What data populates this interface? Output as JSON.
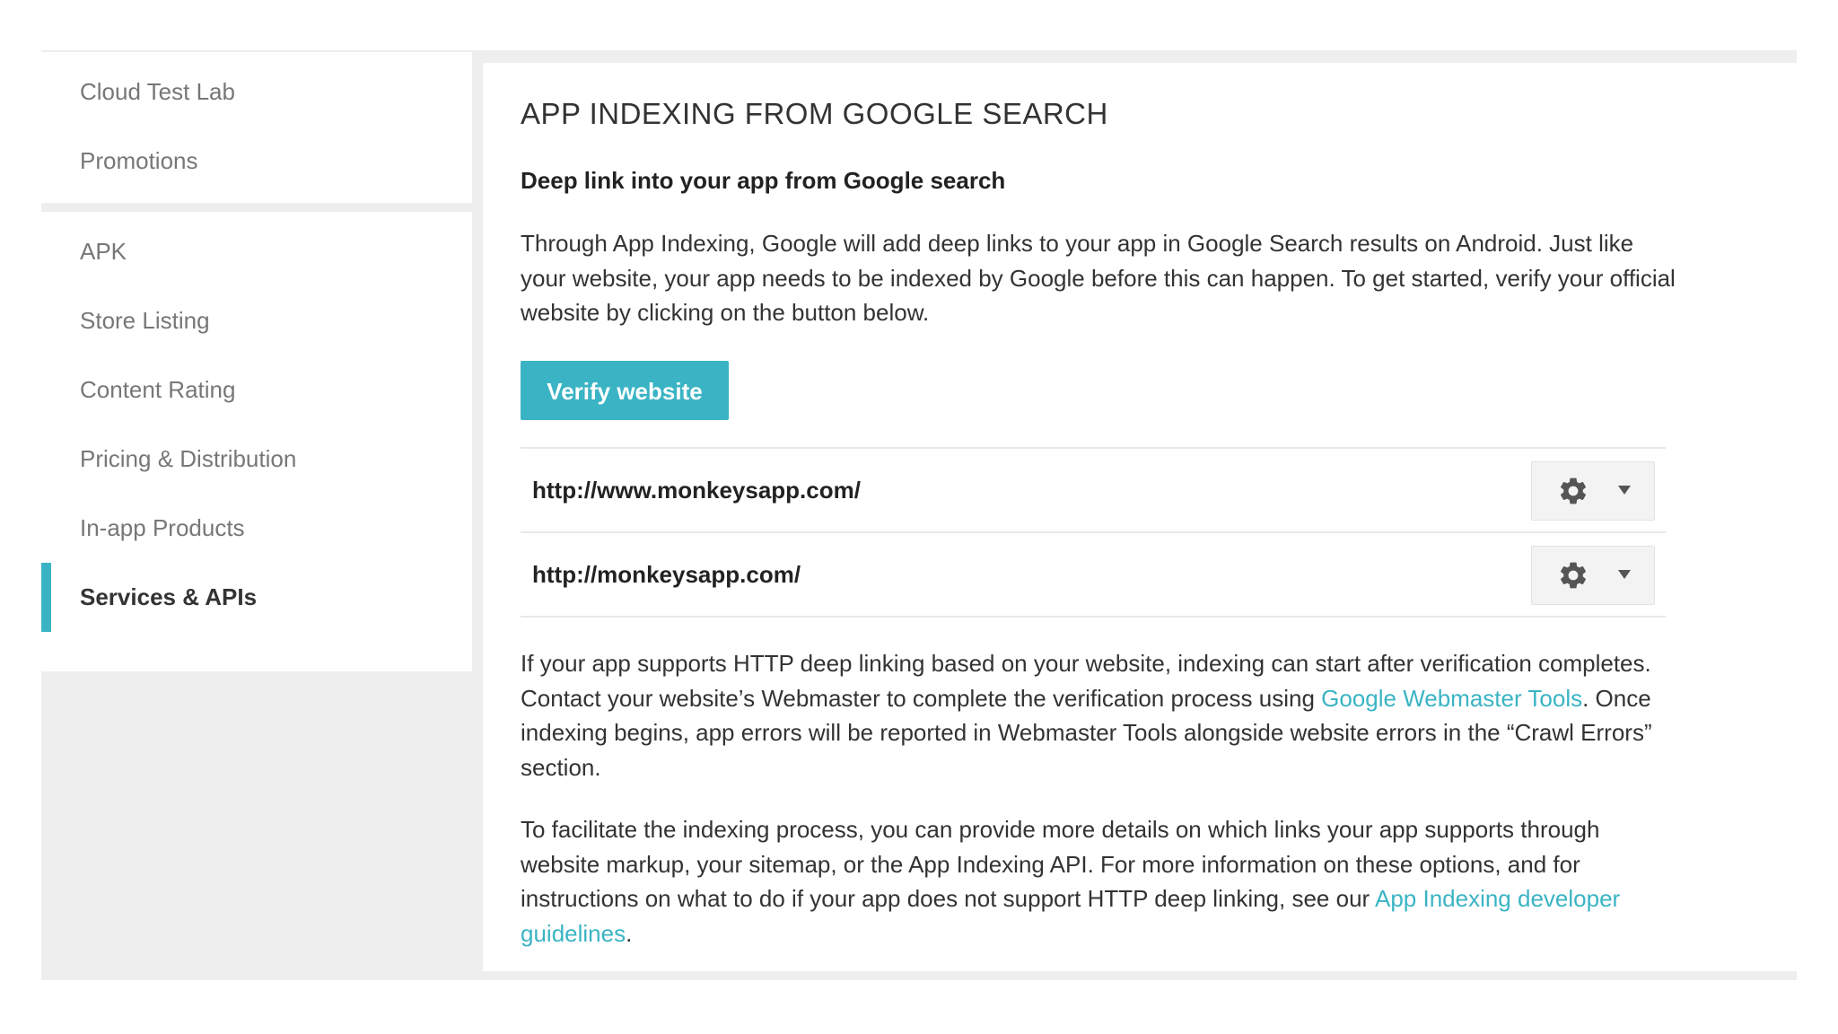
{
  "sidebar": {
    "group1": [
      {
        "label": "Cloud Test Lab"
      },
      {
        "label": "Promotions"
      }
    ],
    "group2": [
      {
        "label": "APK"
      },
      {
        "label": "Store Listing"
      },
      {
        "label": "Content Rating"
      },
      {
        "label": "Pricing & Distribution"
      },
      {
        "label": "In-app Products"
      },
      {
        "label": "Services & APIs",
        "active": true
      }
    ]
  },
  "main": {
    "title": "APP INDEXING FROM GOOGLE SEARCH",
    "subtitle": "Deep link into your app from Google search",
    "intro": "Through App Indexing, Google will add deep links to your app in Google Search results on Android. Just like your website, your app needs to be indexed by Google before this can happen. To get started, verify your official website by clicking on the button below.",
    "verify_button": "Verify website",
    "urls": [
      {
        "url": "http://www.monkeysapp.com/",
        "action_icon": "gear-icon"
      },
      {
        "url": "http://monkeysapp.com/",
        "action_icon": "gear-icon"
      }
    ],
    "para2": {
      "before": "If your app supports HTTP deep linking based on your website, indexing can start after verification completes. Contact your website’s Webmaster to complete the verification process using ",
      "link": "Google Webmaster Tools",
      "after": ". Once indexing begins, app errors will be reported in Webmaster Tools alongside website errors in the “Crawl Errors” section."
    },
    "para3": {
      "before": "To facilitate the indexing process, you can provide more details on which links your app supports through website markup, your sitemap, or the App Indexing API. For more information on these options, and for instructions on what to do if your app does not support HTTP deep linking, see our ",
      "link": "App Indexing developer guidelines",
      "after": "."
    }
  },
  "colors": {
    "accent": "#3ab4c4",
    "background": "#eeeeee"
  }
}
